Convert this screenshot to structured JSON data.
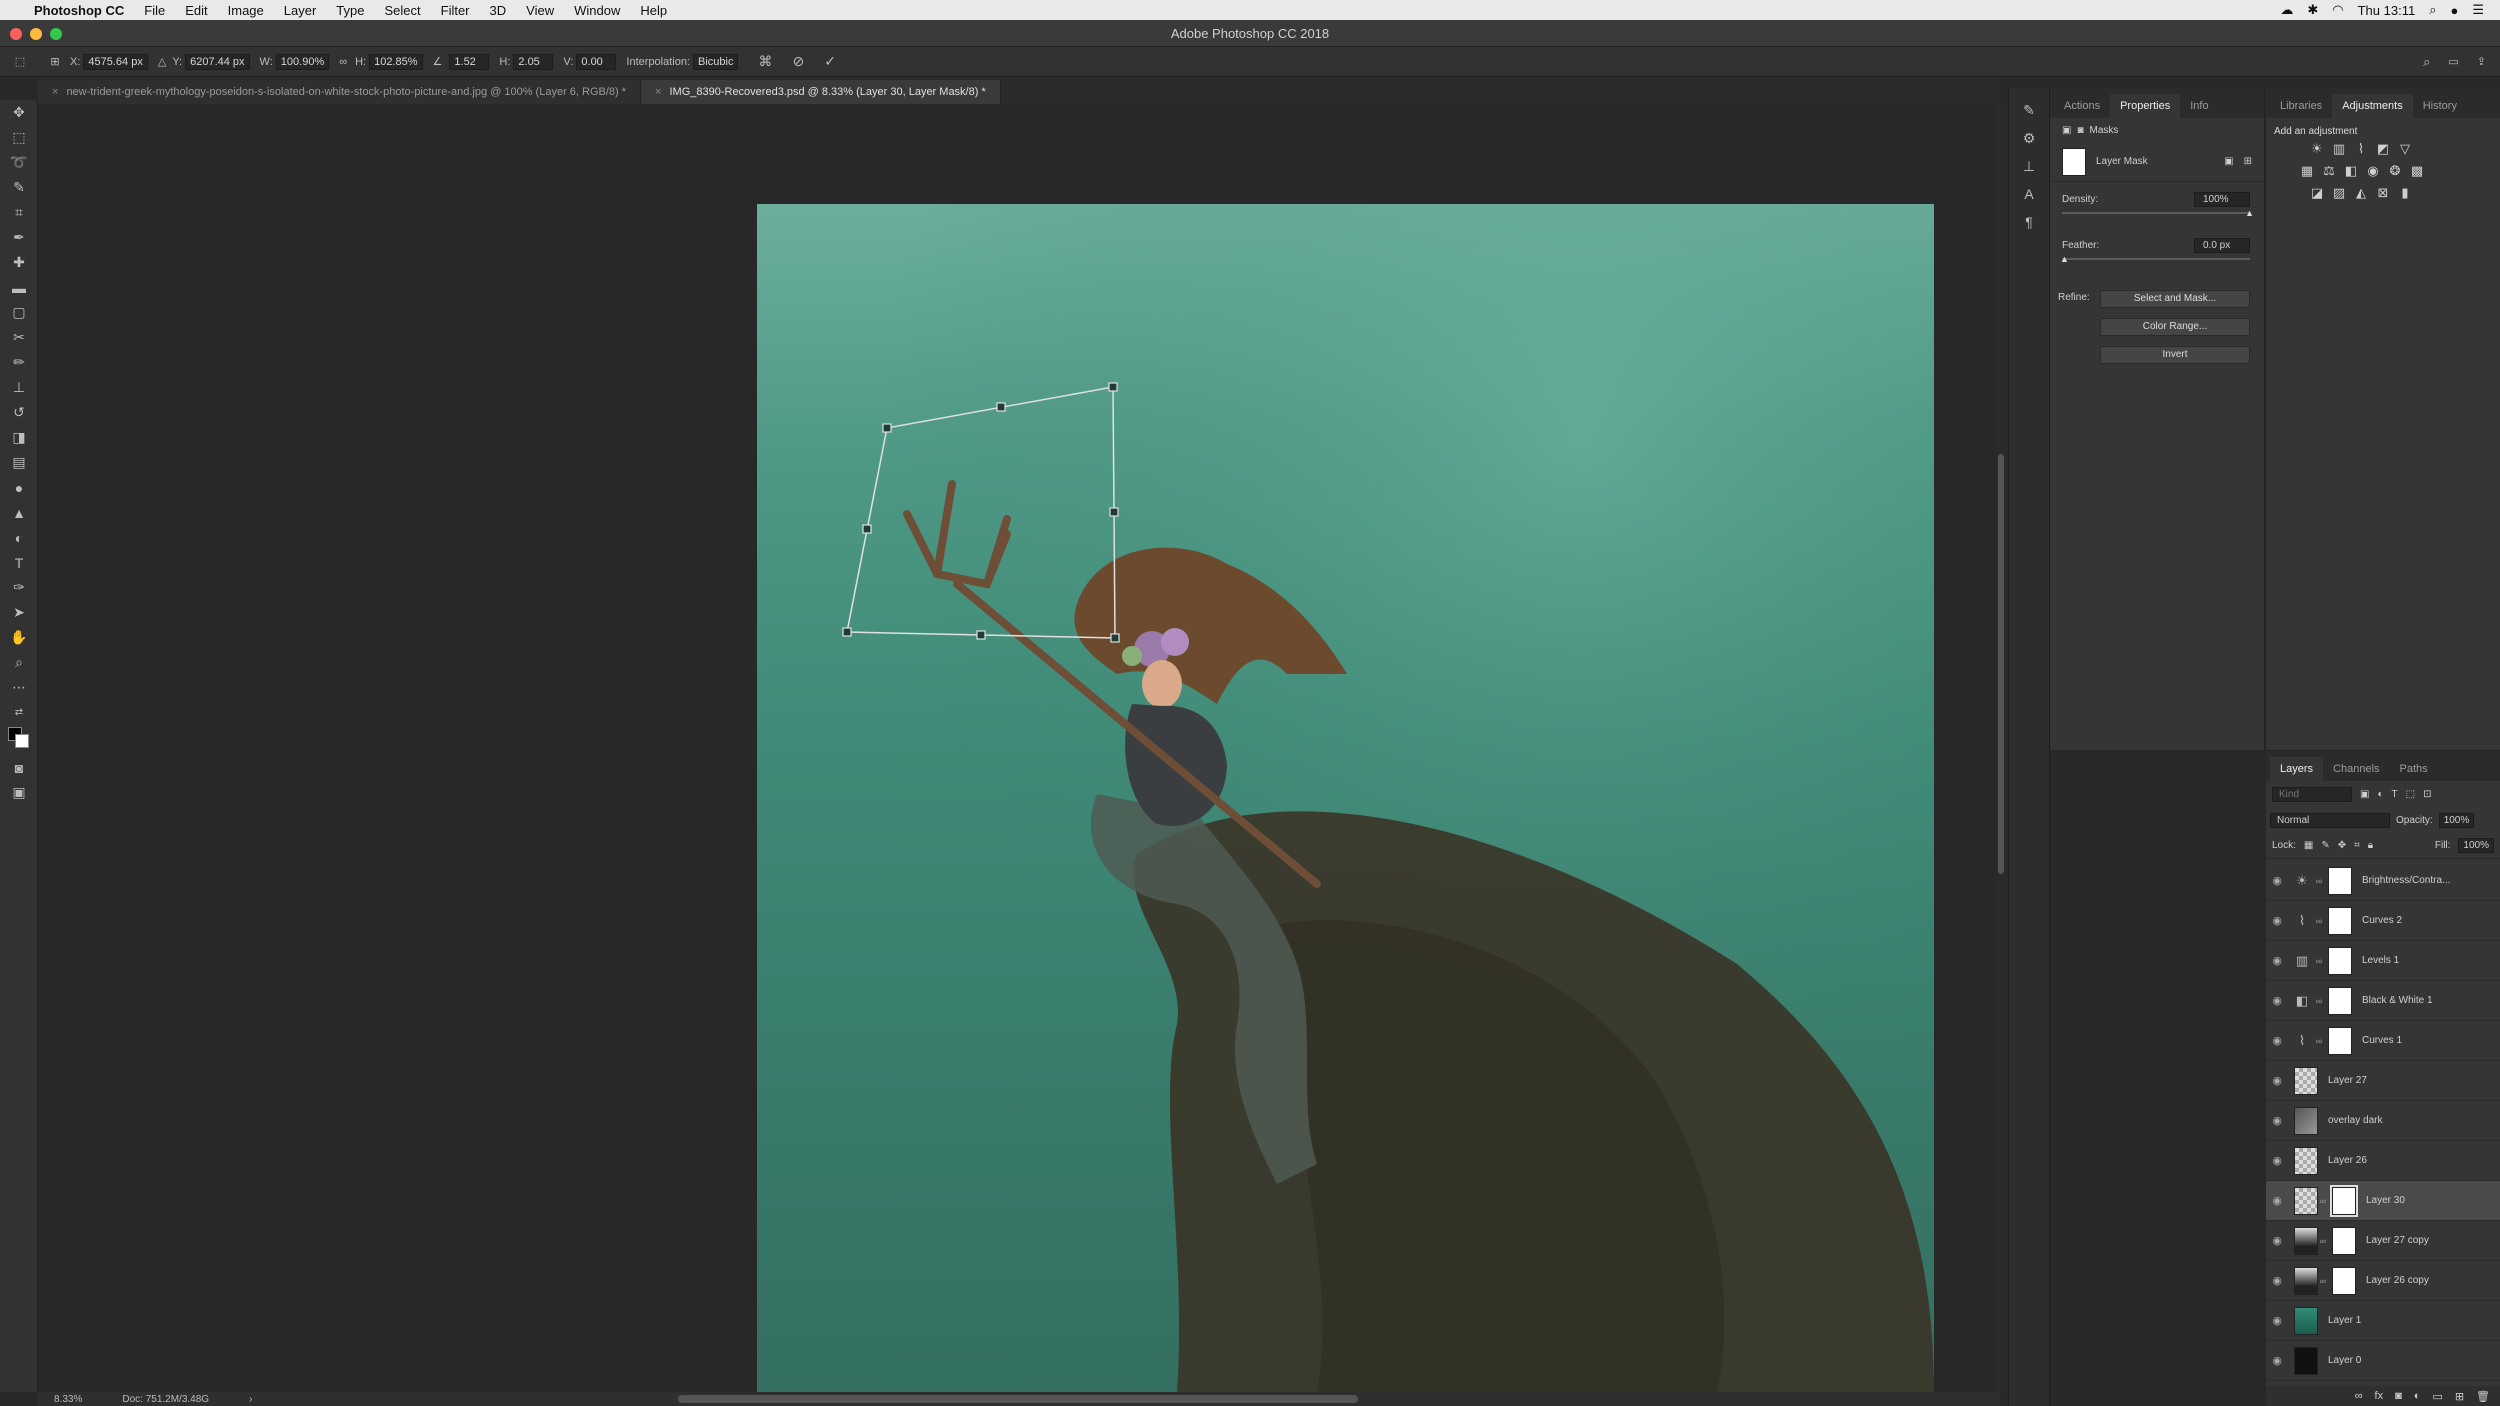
{
  "menubar": {
    "app_name": "Photoshop CC",
    "items": [
      "File",
      "Edit",
      "Image",
      "Layer",
      "Type",
      "Select",
      "Filter",
      "3D",
      "View",
      "Window",
      "Help"
    ],
    "clock": "Thu 13:11"
  },
  "window": {
    "title": "Adobe Photoshop CC 2018"
  },
  "options": {
    "x_label": "X:",
    "x_value": "4575.64 px",
    "y_label": "Y:",
    "y_value": "6207.44 px",
    "w_label": "W:",
    "w_value": "100.90%",
    "h_label": "H:",
    "h_value": "102.85%",
    "angle_value": "1.52",
    "hskew_label": "H:",
    "hskew_value": "2.05",
    "vskew_label": "V:",
    "vskew_value": "0.00",
    "interp_label": "Interpolation:",
    "interp_value": "Bicubic"
  },
  "doc_tabs": [
    {
      "label": "new-trident-greek-mythology-poseidon-s-isolated-on-white-stock-photo-picture-and.jpg @ 100% (Layer 6, RGB/8) *"
    },
    {
      "label": "IMG_8390-Recovered3.psd @ 8.33% (Layer 30, Layer Mask/8) *"
    }
  ],
  "status": {
    "zoom": "8.33%",
    "doc": "Doc: 751.2M/3.48G"
  },
  "properties_panel": {
    "tabs": [
      "Actions",
      "Properties",
      "Info"
    ],
    "masks_label": "Masks",
    "layer_mask_label": "Layer Mask",
    "density_label": "Density:",
    "density_value": "100%",
    "feather_label": "Feather:",
    "feather_value": "0.0 px",
    "refine_label": "Refine:",
    "select_mask_btn": "Select and Mask...",
    "color_range_btn": "Color Range...",
    "invert_btn": "Invert"
  },
  "adjustments_panel": {
    "tabs": [
      "Libraries",
      "Adjustments",
      "History"
    ],
    "heading": "Add an adjustment"
  },
  "layers_panel": {
    "tabs": [
      "Layers",
      "Channels",
      "Paths"
    ],
    "kind_placeholder": "Kind",
    "blend_mode": "Normal",
    "opacity_label": "Opacity:",
    "opacity_value": "100%",
    "lock_label": "Lock:",
    "fill_label": "Fill:",
    "fill_value": "100%",
    "layers": [
      {
        "name": "Brightness/Contra...",
        "kind": "adjustment",
        "icon": "sun-icon"
      },
      {
        "name": "Curves 2",
        "kind": "adjustment",
        "icon": "curves-icon"
      },
      {
        "name": "Levels 1",
        "kind": "adjustment",
        "icon": "levels-icon"
      },
      {
        "name": "Black & White 1",
        "kind": "adjustment",
        "icon": "bw-icon"
      },
      {
        "name": "Curves 1",
        "kind": "adjustment",
        "icon": "curves-icon"
      },
      {
        "name": "Layer 27",
        "kind": "pixel"
      },
      {
        "name": "overlay dark",
        "kind": "pixel"
      },
      {
        "name": "Layer 26",
        "kind": "pixel"
      },
      {
        "name": "Layer 30",
        "kind": "pixel",
        "selected": true
      },
      {
        "name": "Layer 27 copy",
        "kind": "pixel"
      },
      {
        "name": "Layer 26 copy",
        "kind": "pixel"
      },
      {
        "name": "Layer 1",
        "kind": "pixel"
      },
      {
        "name": "Layer 0",
        "kind": "pixel"
      }
    ]
  }
}
